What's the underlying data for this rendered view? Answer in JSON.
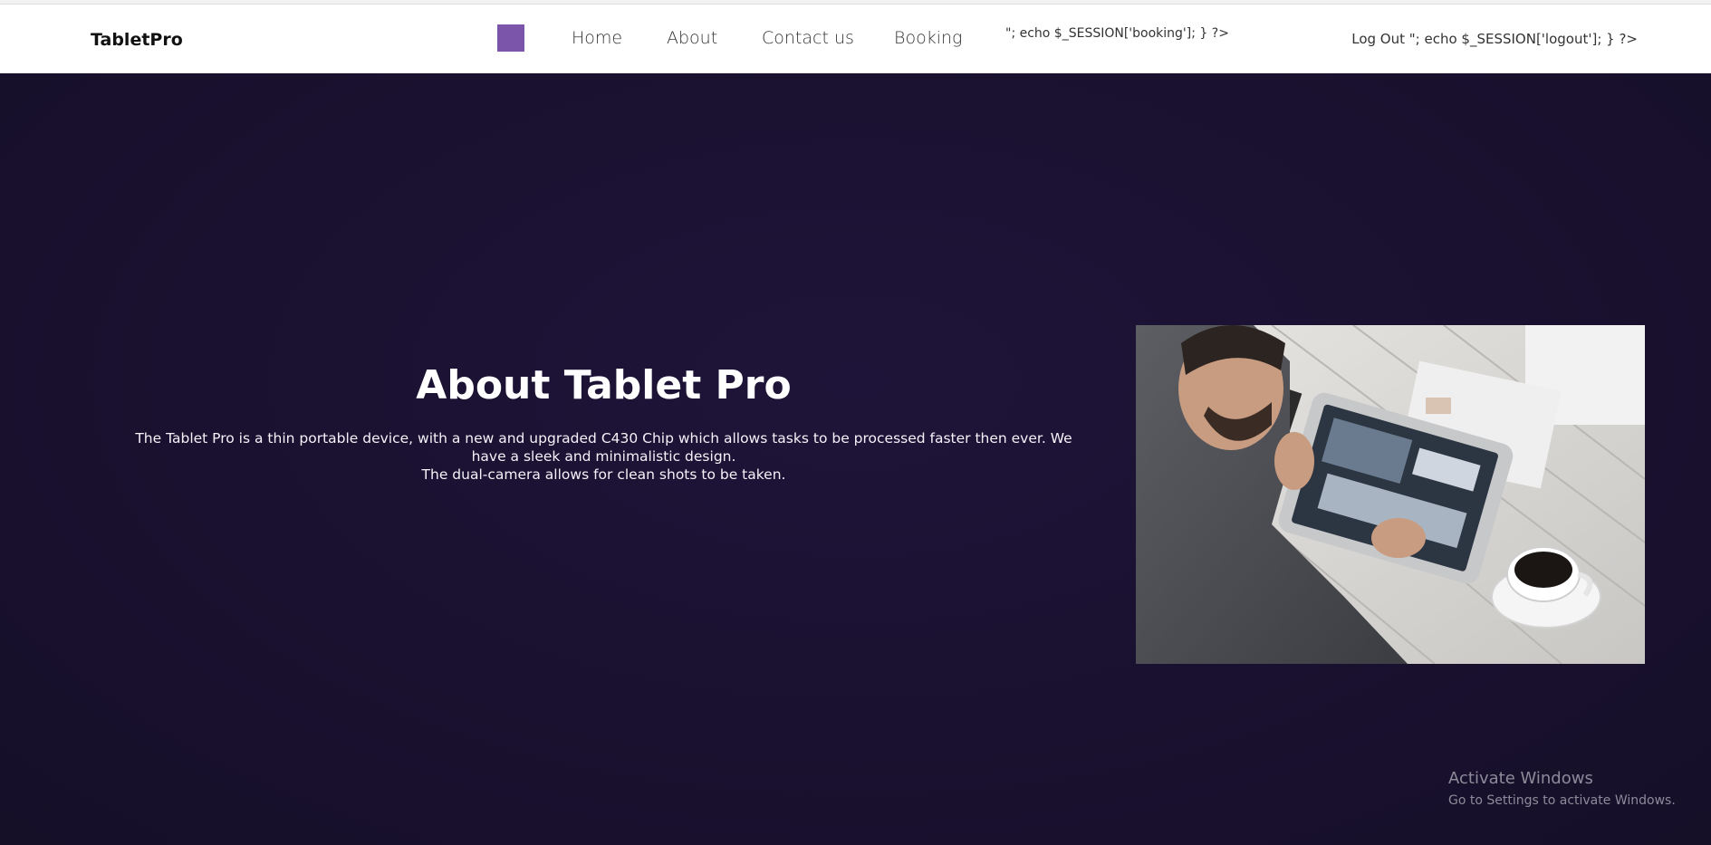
{
  "brand": "TabletPro",
  "nav": {
    "items": [
      "Home",
      "About",
      "Contact us",
      "Booking"
    ],
    "booking_php": "\"; echo $_SESSION['booking']; } ?>",
    "logout": "Log Out \"; echo $_SESSION['logout']; } ?>"
  },
  "about": {
    "title": "About Tablet Pro",
    "paragraph_line1": "The Tablet Pro is a thin portable device, with a new and upgraded C430 Chip which allows tasks to be processed faster then ever. We have a sleek and minimalistic design.",
    "paragraph_line2": "The dual-camera allows for clean shots to be taken."
  },
  "watermark": {
    "title": "Activate Windows",
    "subtitle": "Go to Settings to activate Windows."
  },
  "colors": {
    "accent_square": "#7b55a9",
    "hero_background": "#1b1233",
    "navbar_background": "#ffffff"
  }
}
